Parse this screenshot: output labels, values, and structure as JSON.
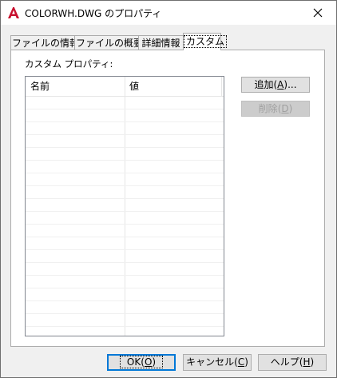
{
  "window": {
    "title": "COLORWH.DWG のプロパティ",
    "app_icon": "autocad-a-icon",
    "close_icon": "close-icon"
  },
  "tabs": [
    {
      "label": "ファイルの情報",
      "active": false
    },
    {
      "label": "ファイルの概要",
      "active": false
    },
    {
      "label": "詳細情報",
      "active": false
    },
    {
      "label": "カスタム",
      "active": true
    }
  ],
  "custom": {
    "section_label": "カスタム プロパティ:",
    "columns": {
      "name": "名前",
      "value": "値"
    },
    "rows": []
  },
  "side_buttons": {
    "add": {
      "text": "追加",
      "mnemonic": "A",
      "suffix": "..."
    },
    "delete": {
      "text": "削除",
      "mnemonic": "D",
      "suffix": "",
      "disabled": true
    }
  },
  "bottom_buttons": {
    "ok": {
      "text": "OK",
      "mnemonic": "O"
    },
    "cancel": {
      "text": "キャンセル",
      "mnemonic": "C"
    },
    "help": {
      "text": "ヘルプ",
      "mnemonic": "H"
    }
  },
  "colors": {
    "app_icon_red": "#c8102e",
    "focus_blue": "#0078d7"
  }
}
